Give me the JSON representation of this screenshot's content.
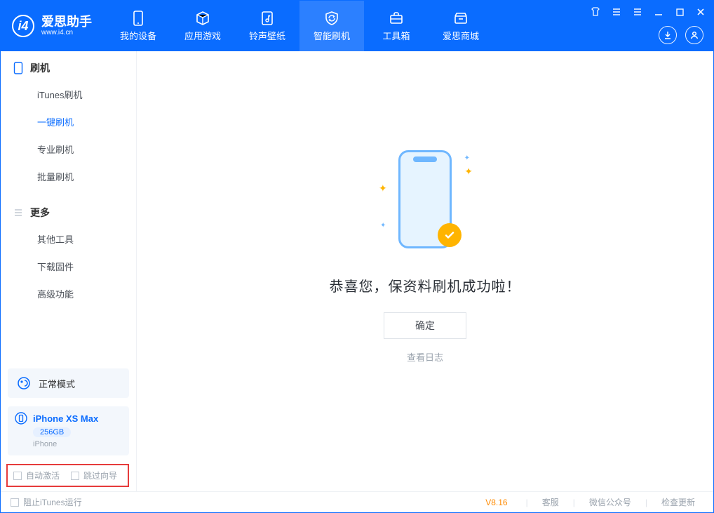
{
  "brand": {
    "cn": "爱思助手",
    "en": "www.i4.cn"
  },
  "nav": [
    {
      "label": "我的设备"
    },
    {
      "label": "应用游戏"
    },
    {
      "label": "铃声壁纸"
    },
    {
      "label": "智能刷机"
    },
    {
      "label": "工具箱"
    },
    {
      "label": "爱思商城"
    }
  ],
  "sidebar": {
    "group1": {
      "title": "刷机",
      "items": [
        "iTunes刷机",
        "一键刷机",
        "专业刷机",
        "批量刷机"
      ]
    },
    "group2": {
      "title": "更多",
      "items": [
        "其他工具",
        "下载固件",
        "高级功能"
      ]
    },
    "modeCard": {
      "label": "正常模式"
    },
    "device": {
      "name": "iPhone XS Max",
      "storage": "256GB",
      "type": "iPhone"
    },
    "opts": {
      "autoActivate": "自动激活",
      "skipGuide": "跳过向导"
    }
  },
  "main": {
    "successMsg": "恭喜您，保资料刷机成功啦！",
    "confirm": "确定",
    "viewLog": "查看日志"
  },
  "status": {
    "blockItunes": "阻止iTunes运行",
    "version": "V8.16",
    "links": [
      "客服",
      "微信公众号",
      "检查更新"
    ]
  }
}
